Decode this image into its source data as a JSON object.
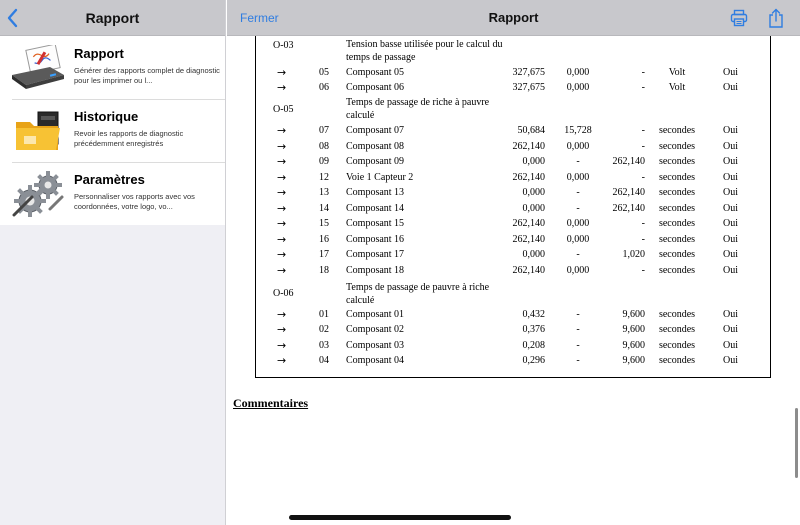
{
  "sidebar": {
    "title": "Rapport",
    "items": [
      {
        "id": "rapport",
        "title": "Rapport",
        "desc": "Générer des rapports complet de diagnostic pour les imprimer ou l...",
        "icon": "printer-icon"
      },
      {
        "id": "historique",
        "title": "Historique",
        "desc": "Revoir les rapports de diagnostic précédemment enregistrés",
        "icon": "folder-icon"
      },
      {
        "id": "parametres",
        "title": "Paramètres",
        "desc": "Personnaliser vos rapports avec vos coordonnées, votre logo, vo...",
        "icon": "gears-icon"
      }
    ]
  },
  "header": {
    "close_label": "Fermer",
    "title": "Rapport",
    "print_icon": "print-icon",
    "share_icon": "share-icon"
  },
  "report": {
    "groups": [
      {
        "code": "O-03",
        "desc_lines": [
          "Tension basse utilisée pour le calcul du",
          "temps de passage"
        ],
        "rows": [
          {
            "arrow": "→",
            "num": "05",
            "name": "Composant 05",
            "v1": "327,675",
            "v2": "0,000",
            "v3": "-",
            "unit": "Volt",
            "ok": "Oui"
          },
          {
            "arrow": "→",
            "num": "06",
            "name": "Composant 06",
            "v1": "327,675",
            "v2": "0,000",
            "v3": "-",
            "unit": "Volt",
            "ok": "Oui"
          }
        ]
      },
      {
        "code": "O-05",
        "desc_lines": [
          "Temps de passage de riche à pauvre",
          "calculé"
        ],
        "rows": [
          {
            "arrow": "→",
            "num": "07",
            "name": "Composant 07",
            "v1": "50,684",
            "v2": "15,728",
            "v3": "-",
            "unit": "secondes",
            "ok": "Oui"
          },
          {
            "arrow": "→",
            "num": "08",
            "name": "Composant 08",
            "v1": "262,140",
            "v2": "0,000",
            "v3": "-",
            "unit": "secondes",
            "ok": "Oui"
          },
          {
            "arrow": "→",
            "num": "09",
            "name": "Composant 09",
            "v1": "0,000",
            "v2": "-",
            "v3": "262,140",
            "unit": "secondes",
            "ok": "Oui"
          },
          {
            "arrow": "→",
            "num": "12",
            "name": "Voie 1 Capteur 2",
            "v1": "262,140",
            "v2": "0,000",
            "v3": "-",
            "unit": "secondes",
            "ok": "Oui"
          },
          {
            "arrow": "→",
            "num": "13",
            "name": "Composant 13",
            "v1": "0,000",
            "v2": "-",
            "v3": "262,140",
            "unit": "secondes",
            "ok": "Oui"
          },
          {
            "arrow": "→",
            "num": "14",
            "name": "Composant 14",
            "v1": "0,000",
            "v2": "-",
            "v3": "262,140",
            "unit": "secondes",
            "ok": "Oui"
          },
          {
            "arrow": "→",
            "num": "15",
            "name": "Composant 15",
            "v1": "262,140",
            "v2": "0,000",
            "v3": "-",
            "unit": "secondes",
            "ok": "Oui"
          },
          {
            "arrow": "→",
            "num": "16",
            "name": "Composant 16",
            "v1": "262,140",
            "v2": "0,000",
            "v3": "-",
            "unit": "secondes",
            "ok": "Oui"
          },
          {
            "arrow": "→",
            "num": "17",
            "name": "Composant 17",
            "v1": "0,000",
            "v2": "-",
            "v3": "1,020",
            "unit": "secondes",
            "ok": "Oui"
          },
          {
            "arrow": "→",
            "num": "18",
            "name": "Composant 18",
            "v1": "262,140",
            "v2": "0,000",
            "v3": "-",
            "unit": "secondes",
            "ok": "Oui"
          }
        ]
      },
      {
        "code": "O-06",
        "desc_lines": [
          "Temps de passage de pauvre à riche",
          "calculé"
        ],
        "rows": [
          {
            "arrow": "→",
            "num": "01",
            "name": "Composant 01",
            "v1": "0,432",
            "v2": "-",
            "v3": "9,600",
            "unit": "secondes",
            "ok": "Oui"
          },
          {
            "arrow": "→",
            "num": "02",
            "name": "Composant 02",
            "v1": "0,376",
            "v2": "-",
            "v3": "9,600",
            "unit": "secondes",
            "ok": "Oui"
          },
          {
            "arrow": "→",
            "num": "03",
            "name": "Composant 03",
            "v1": "0,208",
            "v2": "-",
            "v3": "9,600",
            "unit": "secondes",
            "ok": "Oui"
          },
          {
            "arrow": "→",
            "num": "04",
            "name": "Composant 04",
            "v1": "0,296",
            "v2": "-",
            "v3": "9,600",
            "unit": "secondes",
            "ok": "Oui"
          }
        ]
      }
    ],
    "comments_title": "Commentaires"
  },
  "colors": {
    "accent": "#2f7de1",
    "header_bg": "#c8c8cc",
    "sidebar_bg": "#efeff4"
  }
}
